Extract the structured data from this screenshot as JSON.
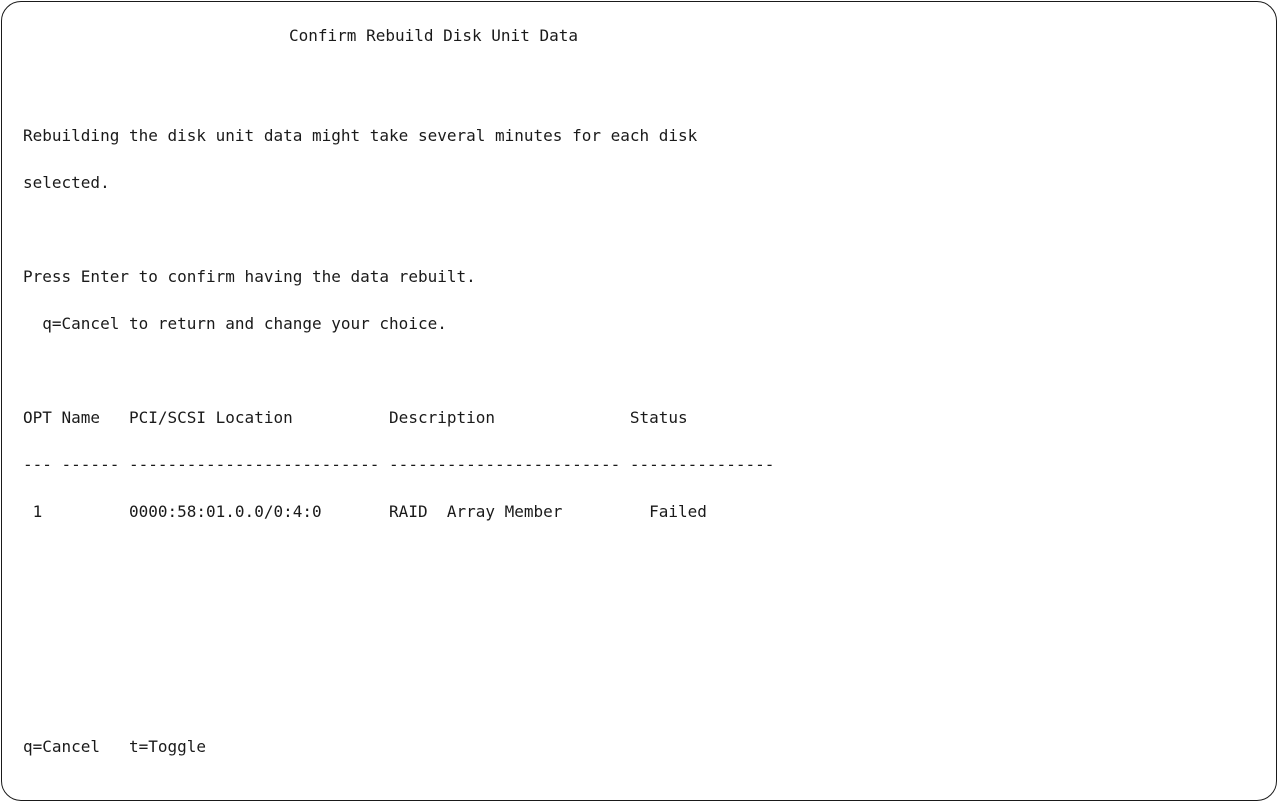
{
  "screen": {
    "title": "Confirm Rebuild Disk Unit Data",
    "message_line1": "Rebuilding the disk unit data might take several minutes for each disk",
    "message_line2": "selected.",
    "instruction": "Press Enter to confirm having the data rebuilt.",
    "cancel_hint": "  q=Cancel to return and change your choice.",
    "table": {
      "header": "OPT Name   PCI/SCSI Location          Description              Status",
      "separator": "--- ------ -------------------------- ------------------------ ---------------",
      "rows": [
        " 1         0000:58:01.0.0/0:4:0       RAID  Array Member         Failed"
      ]
    },
    "footer_keys": "q=Cancel   t=Toggle"
  },
  "colors": {
    "text": "#1a1a1a",
    "background": "#ffffff",
    "border": "#1a1a1a"
  }
}
